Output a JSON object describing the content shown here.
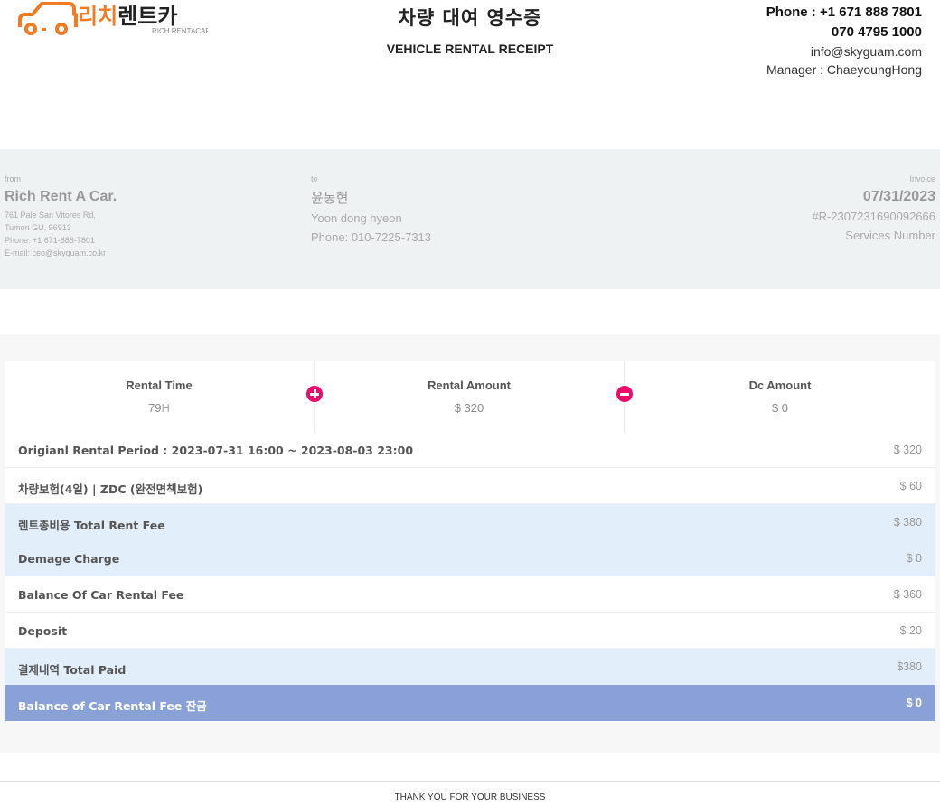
{
  "header": {
    "logo": {
      "korean": "리치렌트카",
      "korean_orange": "리치",
      "korean_black": "렌트카",
      "english": "RICH RENTACAR"
    },
    "title_ko": "차량 대여 영수증",
    "title_en": "VEHICLE RENTAL RECEIPT",
    "contact": {
      "phone": "Phone : +1 671 888 7801",
      "phone2": "070 4795 1000",
      "email": "info@skyguam.com",
      "manager": "Manager : ChaeyoungHong"
    }
  },
  "from": {
    "label": "from",
    "name": "Rich Rent A Car.",
    "address1": "761 Pale San Vitores Rd,",
    "address2": "Tumon GU, 96913",
    "phone": "Phone: +1 671-888-7801",
    "email": "E-mail: ceo@skyguam.co.kr"
  },
  "to": {
    "label": "to",
    "name_ko": "윤동현",
    "name_en": "Yoon dong hyeon",
    "phone": "Phone: 010-7225-7313"
  },
  "invoice": {
    "label": "Invoice",
    "date": "07/31/2023",
    "number": "#R-2307231690092666",
    "services": "Services Number"
  },
  "summary": {
    "rental_time": {
      "label": "Rental Time",
      "value_num": "79",
      "value_unit": "H"
    },
    "rental_amount": {
      "label": "Rental Amount",
      "value": "$ 320"
    },
    "dc_amount": {
      "label": "Dc Amount",
      "value": "$ 0"
    }
  },
  "rows": [
    {
      "label": "Origianl Rental Period : 2023-07-31 16:00 ~ 2023-08-03 23:00",
      "value": "$ 320",
      "style": "white"
    },
    {
      "label": "차량보험(4일) | ZDC (완전면책보험)",
      "value": "$ 60",
      "style": "white"
    },
    {
      "label": "렌트총비용 Total Rent Fee",
      "value": "$ 380",
      "style": "blue"
    },
    {
      "label": "Demage Charge",
      "value": "$ 0",
      "style": "blue"
    },
    {
      "label": "Balance Of Car Rental Fee",
      "value": "$ 360",
      "style": "white"
    },
    {
      "label": "Deposit",
      "value": "$ 20",
      "style": "white"
    },
    {
      "label": "결제내역 Total Paid",
      "value": "$380",
      "style": "blue"
    },
    {
      "label": "Balance of Car Rental Fee 잔금",
      "value": "$ 0",
      "style": "dark"
    }
  ],
  "footer": "THANK YOU FOR YOUR BUSINESS",
  "colors": {
    "brand_orange": "#f07b22",
    "accent_pink": "#ec0b6a",
    "row_blue": "#e3eefb",
    "row_dark": "#8aa1d8"
  }
}
